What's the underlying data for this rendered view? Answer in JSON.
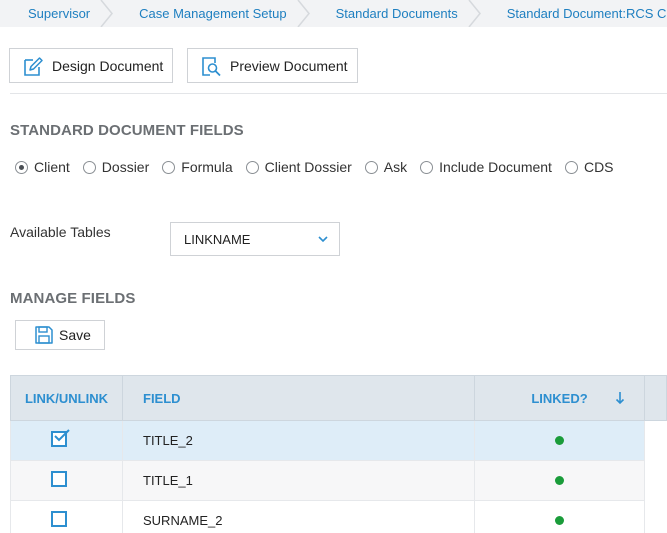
{
  "breadcrumb": [
    {
      "label": "Supervisor"
    },
    {
      "label": "Case Management Setup"
    },
    {
      "label": "Standard Documents"
    },
    {
      "label": "Standard Document:RCS Cli"
    }
  ],
  "toolbar": {
    "design_label": "Design Document",
    "preview_label": "Preview Document"
  },
  "fields_section": {
    "title": "STANDARD DOCUMENT FIELDS",
    "radios": [
      {
        "label": "Client",
        "selected": true
      },
      {
        "label": "Dossier",
        "selected": false
      },
      {
        "label": "Formula",
        "selected": false
      },
      {
        "label": "Client Dossier",
        "selected": false
      },
      {
        "label": "Ask",
        "selected": false
      },
      {
        "label": "Include Document",
        "selected": false
      },
      {
        "label": "CDS",
        "selected": false
      }
    ],
    "available_tables_label": "Available Tables",
    "available_tables_value": "LINKNAME"
  },
  "manage_section": {
    "title": "MANAGE FIELDS",
    "save_label": "Save"
  },
  "table": {
    "headers": {
      "link": "LINK/UNLINK",
      "field": "FIELD",
      "linked": "LINKED?"
    },
    "rows": [
      {
        "field": "TITLE_2",
        "checked": true,
        "linked": true
      },
      {
        "field": "TITLE_1",
        "checked": false,
        "linked": true
      },
      {
        "field": "SURNAME_2",
        "checked": false,
        "linked": true
      }
    ]
  },
  "colors": {
    "link_blue": "#2d8fd0",
    "linked_green": "#1a9c3a",
    "selected_row": "#deedf8"
  },
  "icons": {
    "design": "edit-document-icon",
    "preview": "preview-document-icon",
    "save": "save-icon",
    "sort": "sort-down-icon",
    "dropdown": "chevron-down-icon"
  }
}
